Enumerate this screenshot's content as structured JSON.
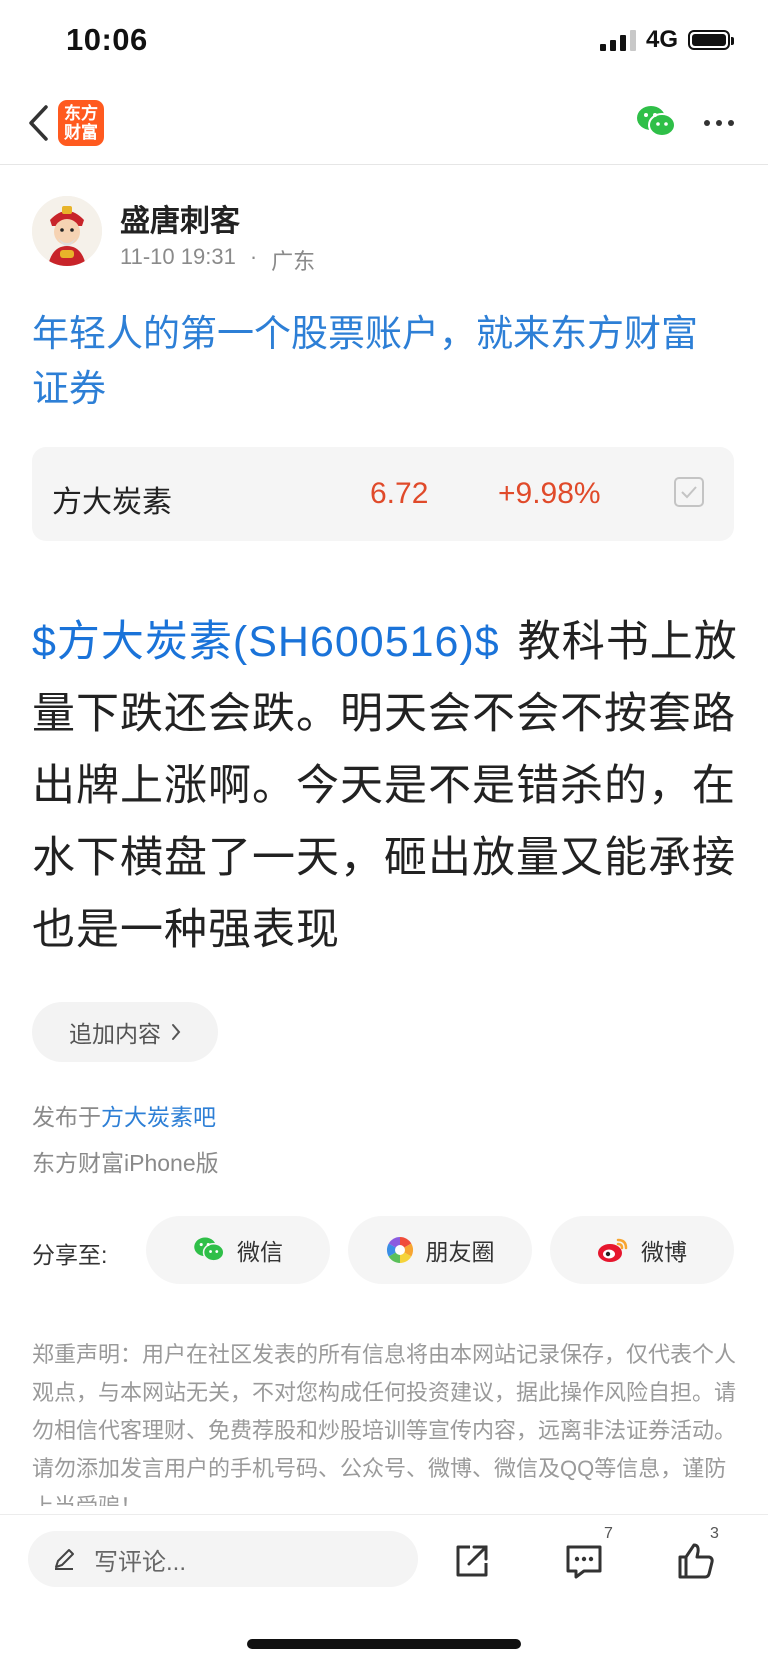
{
  "status_bar": {
    "time": "10:06",
    "network": "4G"
  },
  "nav": {
    "logo_line1": "东方",
    "logo_line2": "财富"
  },
  "author": {
    "name": "盛唐刺客",
    "datetime": "11-10 19:31",
    "location": "广东"
  },
  "ad_title": "年轻人的第一个股票账户，就来东方财富证券",
  "stock_card": {
    "name": "方大炭素",
    "price": "6.72",
    "change": "+9.98%"
  },
  "post": {
    "stock_tag": "$方大炭素(SH600516)$",
    "text": "教科书上放量下跌还会跌。明天会不会不按套路出牌上涨啊。今天是不是错杀的，在水下横盘了一天，砸出放量又能承接也是一种强表现"
  },
  "append_label": "追加内容",
  "publish": {
    "prefix": "发布于",
    "forum": "方大炭素吧",
    "client": "东方财富iPhone版"
  },
  "share": {
    "label": "分享至:",
    "wechat": "微信",
    "moments": "朋友圈",
    "weibo": "微博"
  },
  "disclaimer": "郑重声明：用户在社区发表的所有信息将由本网站记录保存，仅代表个人观点，与本网站无关，不对您构成任何投资建议，据此操作风险自担。请勿相信代客理财、免费荐股和炒股培训等宣传内容，远离非法证券活动。请勿添加发言用户的手机号码、公众号、微博、微信及QQ等信息，谨防上当受骗！",
  "bottom_bar": {
    "comment_placeholder": "写评论...",
    "comment_count": "7",
    "like_count": "3"
  },
  "colors": {
    "brand": "#ff5a1f",
    "link": "#2d7fd6",
    "up": "#e04a2a"
  }
}
